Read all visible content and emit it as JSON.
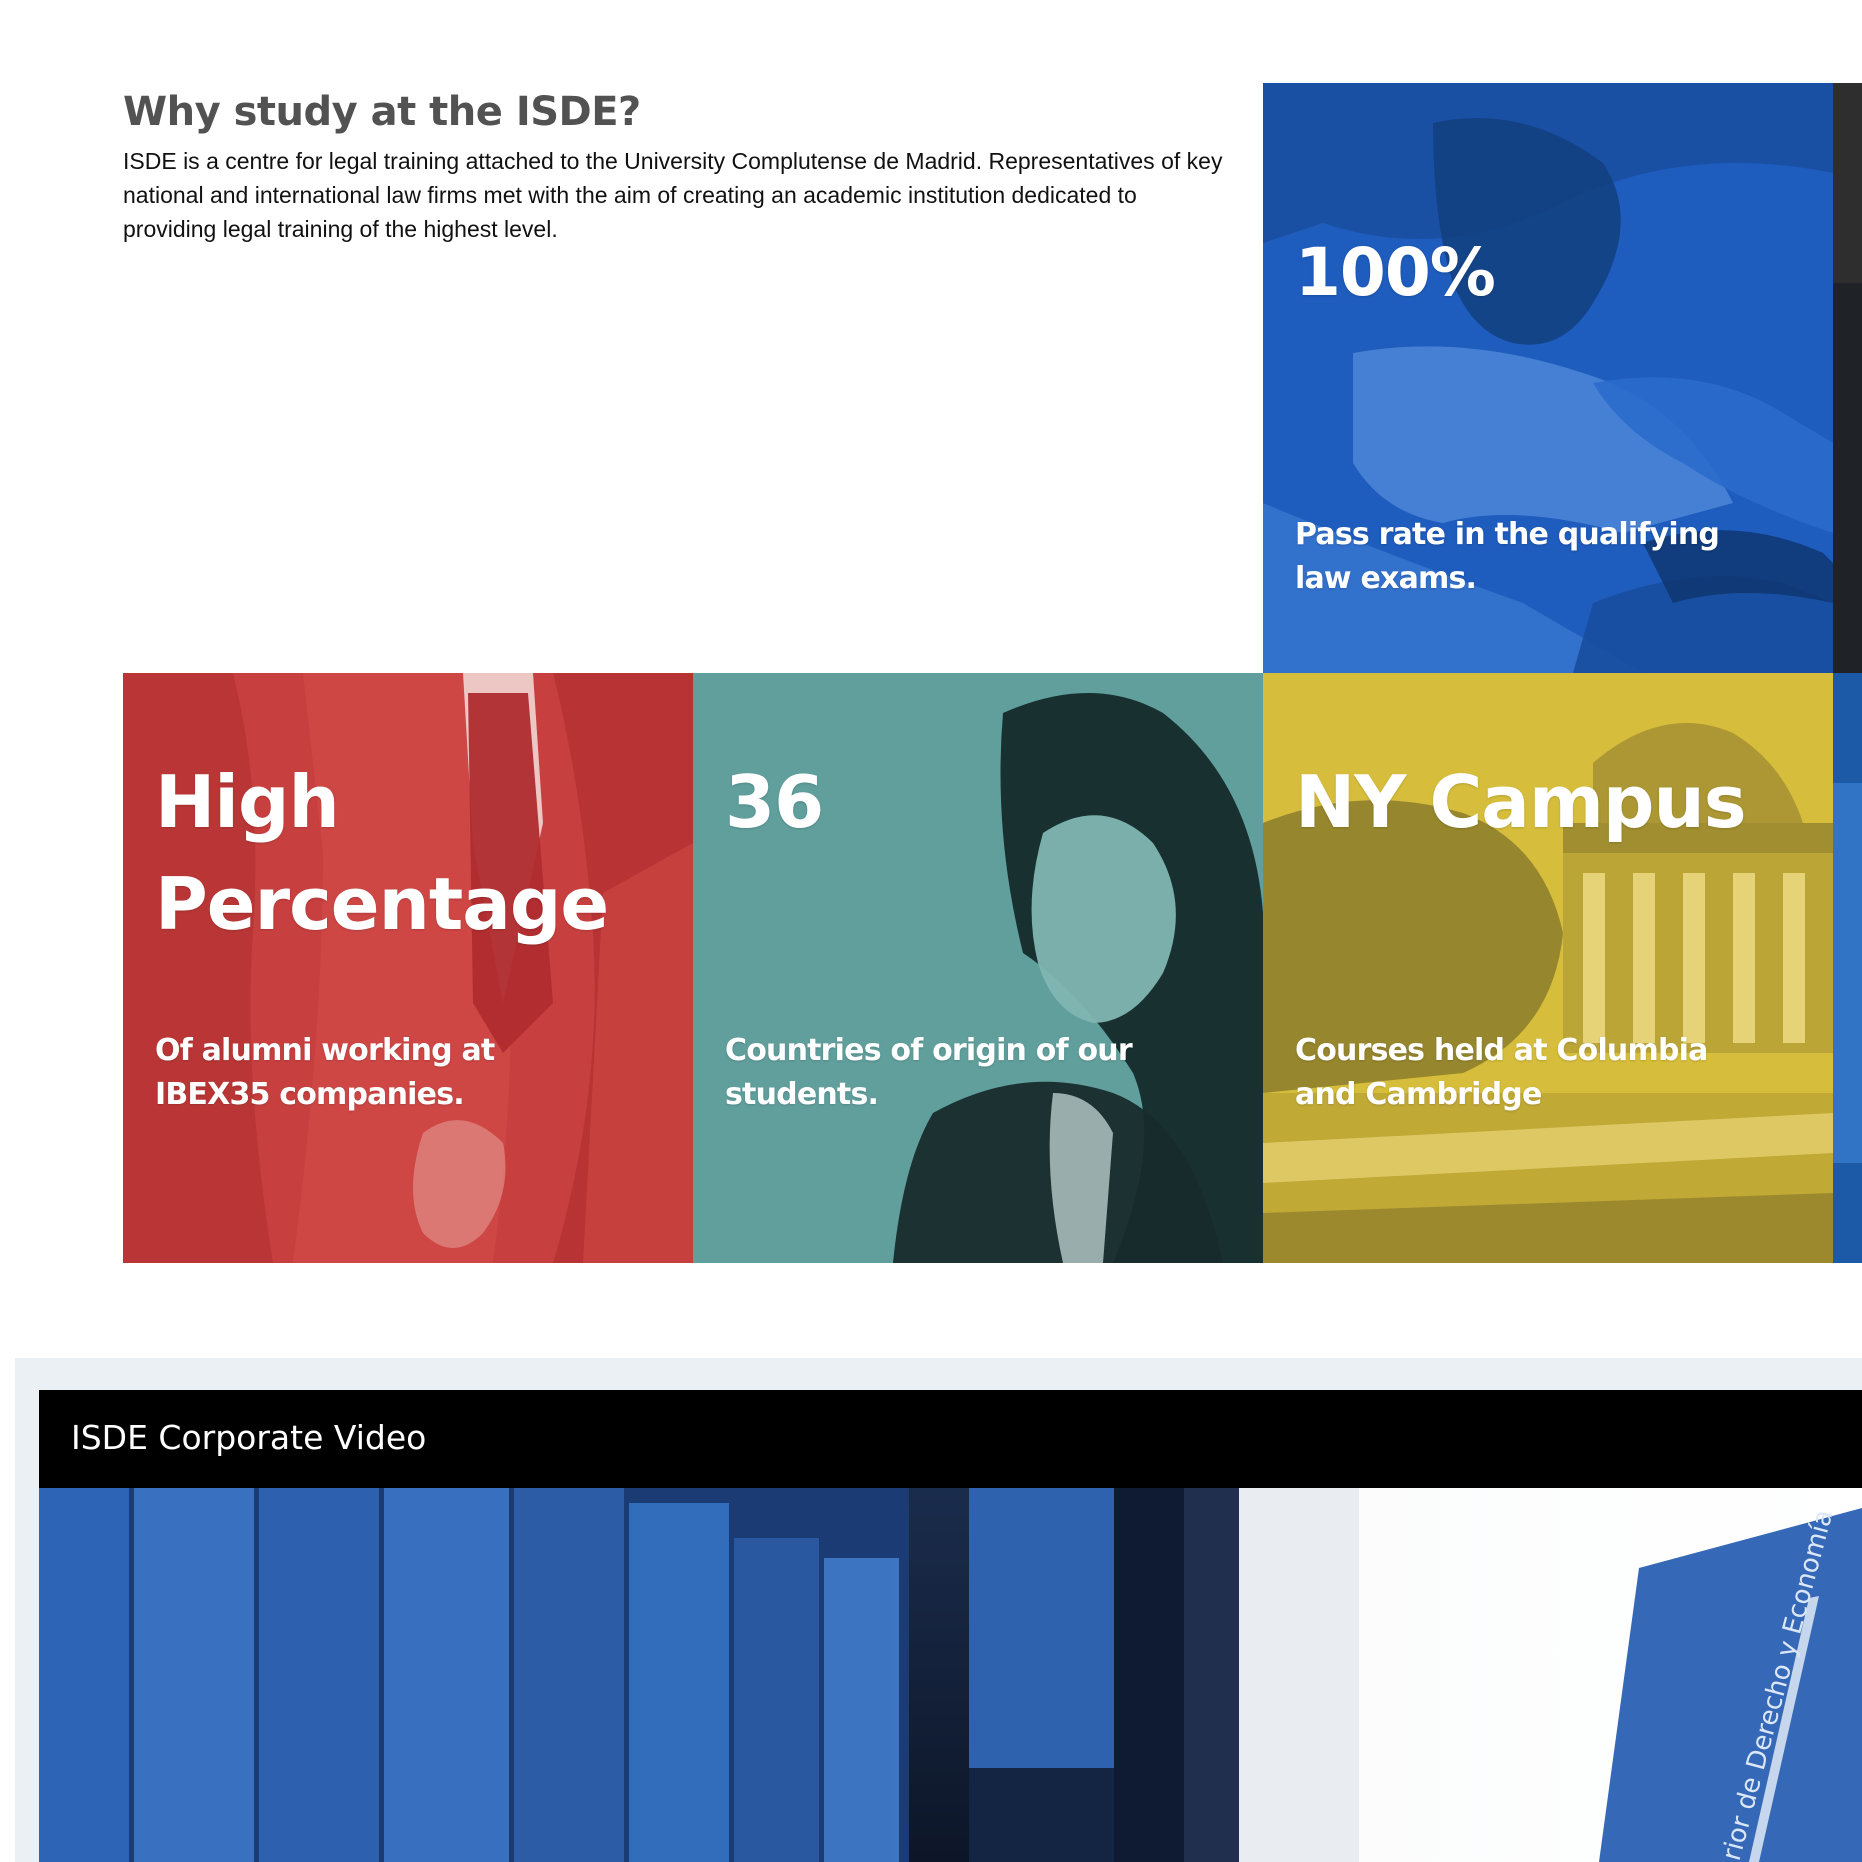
{
  "intro": {
    "title": "Why study at the ISDE?",
    "body": "ISDE is a centre for legal training attached to the University Complutense de Madrid. Representatives of key national and international law firms met with the aim of creating an academic institution dedicated to providing legal training of the highest level."
  },
  "tiles": [
    {
      "headline": "100%",
      "caption": "Pass rate in the qualifying law exams.",
      "color": "#1f5fbf"
    },
    {
      "headline": "High Percentage",
      "caption": "Of alumni working at IBEX35 companies.",
      "color": "#c43b3b"
    },
    {
      "headline": "36",
      "caption": "Countries of origin of our students.",
      "color": "#5e9d9a"
    },
    {
      "headline": "NY Campus",
      "caption": "Courses held at Columbia and Cambridge",
      "color": "#d4b93a"
    }
  ],
  "video": {
    "title": "ISDE Corporate Video",
    "book_spine_text": "rior de Derecho y Economía"
  }
}
